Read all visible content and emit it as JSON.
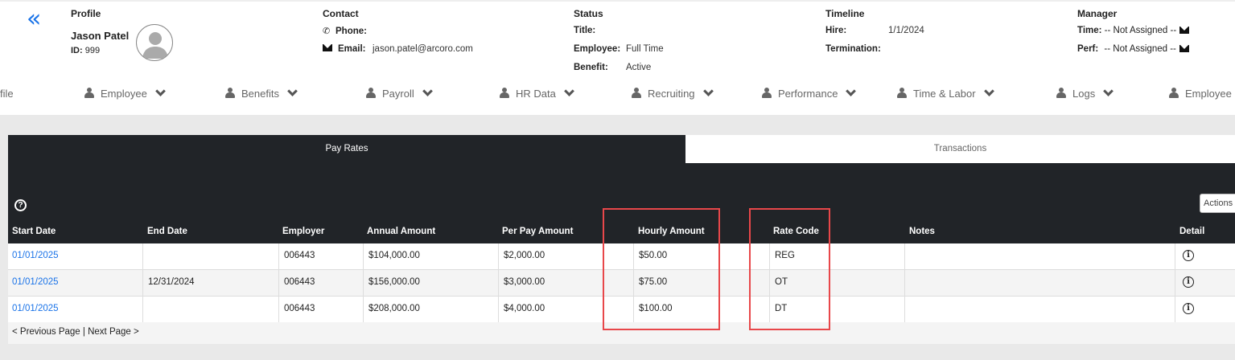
{
  "profile": {
    "heading": "Profile",
    "name": "Jason Patel",
    "id_label": "ID:",
    "id_value": "999"
  },
  "contact": {
    "heading": "Contact",
    "phone_label": "Phone:",
    "phone_value": "",
    "email_label": "Email:",
    "email_value": "jason.patel@arcoro.com"
  },
  "status": {
    "heading": "Status",
    "title_label": "Title:",
    "title_value": "",
    "employee_label": "Employee:",
    "employee_value": "Full Time",
    "benefit_label": "Benefit:",
    "benefit_value": "Active"
  },
  "timeline": {
    "heading": "Timeline",
    "hire_label": "Hire:",
    "hire_value": "1/1/2024",
    "termination_label": "Termination:",
    "termination_value": ""
  },
  "manager": {
    "heading": "Manager",
    "time_label": "Time:",
    "time_value": "-- Not Assigned --",
    "perf_label": "Perf:",
    "perf_value": "-- Not Assigned --"
  },
  "nav": {
    "items": [
      "file",
      "Employee",
      "Benefits",
      "Payroll",
      "HR Data",
      "Recruiting",
      "Performance",
      "Time & Labor",
      "Logs",
      "Employee"
    ]
  },
  "tabs": {
    "active": "Pay Rates",
    "inactive": "Transactions"
  },
  "help_icon": "?",
  "actions_label": "Actions",
  "table": {
    "columns": [
      "Start Date",
      "End Date",
      "Employer",
      "Annual Amount",
      "Per Pay Amount",
      "Hourly Amount",
      "Rate Code",
      "Notes",
      "Detail"
    ],
    "rows": [
      {
        "start": "01/01/2025",
        "end": "",
        "employer": "006443",
        "annual": "$104,000.00",
        "perpay": "$2,000.00",
        "hourly": "$50.00",
        "code": "REG",
        "notes": ""
      },
      {
        "start": "01/01/2025",
        "end": "12/31/2024",
        "employer": "006443",
        "annual": "$156,000.00",
        "perpay": "$3,000.00",
        "hourly": "$75.00",
        "code": "OT",
        "notes": ""
      },
      {
        "start": "01/01/2025",
        "end": "",
        "employer": "006443",
        "annual": "$208,000.00",
        "perpay": "$4,000.00",
        "hourly": "$100.00",
        "code": "DT",
        "notes": ""
      }
    ]
  },
  "pager": {
    "previous": "< Previous Page",
    "separator": " | ",
    "next": "Next Page >"
  },
  "icons": {
    "back": "double-chevron-left-icon",
    "info": "info-icon",
    "help": "help-icon",
    "person": "person-icon",
    "mail": "envelope-icon",
    "phone": "phone-icon"
  },
  "colors": {
    "accent": "#1a73e8",
    "panel": "#212428",
    "highlight": "#e8474a"
  }
}
